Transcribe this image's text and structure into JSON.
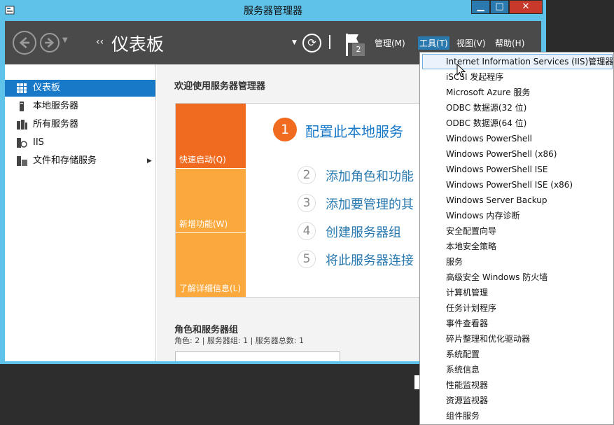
{
  "window": {
    "title": "服务器管理器",
    "controls": {
      "minimize": "▁",
      "maximize": "□",
      "close": "✕"
    }
  },
  "toolbar": {
    "breadcrumb_arrows": "‹‹",
    "breadcrumb_title": "仪表板",
    "notification_count": "2",
    "menus": [
      "管理(M)",
      "工具(T)",
      "视图(V)",
      "帮助(H)"
    ]
  },
  "sidebar": {
    "items": [
      {
        "label": "仪表板",
        "icon": "dashboard-icon"
      },
      {
        "label": "本地服务器",
        "icon": "server-icon"
      },
      {
        "label": "所有服务器",
        "icon": "servers-icon"
      },
      {
        "label": "IIS",
        "icon": "iis-icon"
      },
      {
        "label": "文件和存储服务",
        "icon": "file-storage-icon"
      }
    ]
  },
  "main": {
    "welcome_title": "欢迎使用服务器管理器",
    "tiles": [
      "快速启动(Q)",
      "新增功能(W)",
      "了解详细信息(L)"
    ],
    "steps": [
      {
        "num": "1",
        "text": "配置此本地服务"
      },
      {
        "num": "2",
        "text": "添加角色和功能"
      },
      {
        "num": "3",
        "text": "添加要管理的其"
      },
      {
        "num": "4",
        "text": "创建服务器组"
      },
      {
        "num": "5",
        "text": "将此服务器连接"
      }
    ],
    "roles_title": "角色和服务器组",
    "roles_summary": "角色: 2 | 服务器组: 1 | 服务器总数: 1"
  },
  "tools_menu": {
    "items": [
      "Internet Information Services (IIS)管理器",
      "iSCSI 发起程序",
      "Microsoft Azure 服务",
      "ODBC 数据源(32 位)",
      "ODBC 数据源(64 位)",
      "Windows PowerShell",
      "Windows PowerShell (x86)",
      "Windows PowerShell ISE",
      "Windows PowerShell ISE (x86)",
      "Windows Server Backup",
      "Windows 内存诊断",
      "安全配置向导",
      "本地安全策略",
      "服务",
      "高级安全 Windows 防火墙",
      "计算机管理",
      "任务计划程序",
      "事件查看器",
      "碎片整理和优化驱动器",
      "系统配置",
      "系统信息",
      "性能监视器",
      "资源监视器",
      "组件服务"
    ]
  }
}
